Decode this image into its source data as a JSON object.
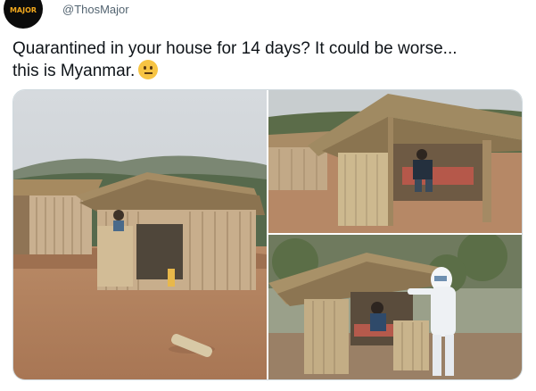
{
  "account": {
    "avatar_text": "MAJOR",
    "handle": "@ThosMajor"
  },
  "tweet": {
    "line1": "Quarantined in your house for 14 days? It could be worse...",
    "line2": "this is Myanmar.",
    "emoji_icon": "neutral-face-icon"
  },
  "media": {
    "photo_count": 3
  },
  "colors": {
    "handle": "#536471",
    "text": "#0f1419",
    "border": "#cfd9de",
    "avatar_accent": "#f2a81d"
  }
}
